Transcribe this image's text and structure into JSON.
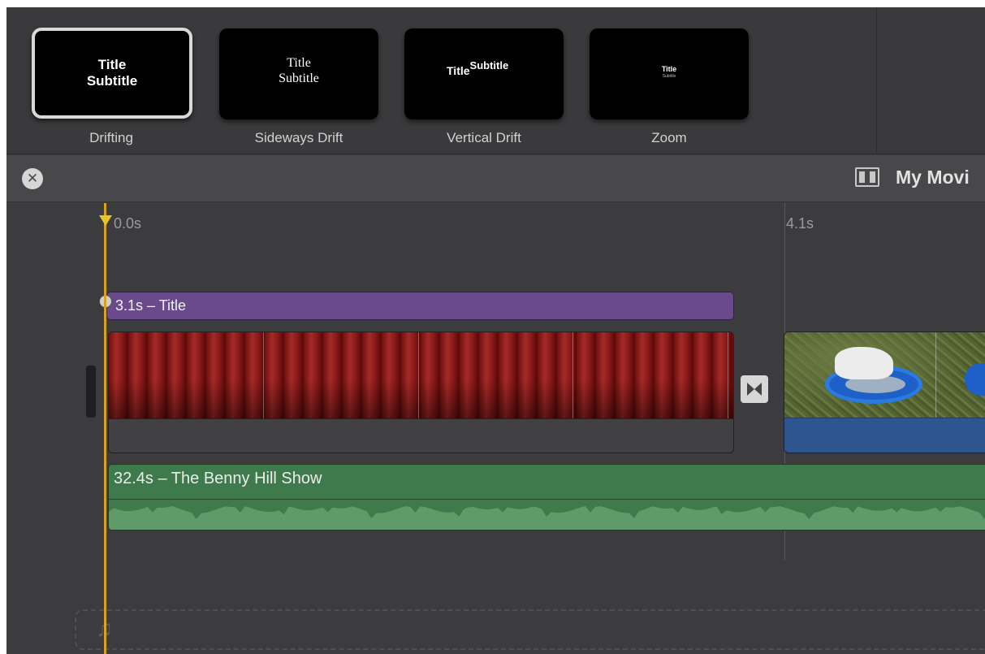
{
  "title_styles": [
    {
      "name": "Drifting",
      "preview_title": "Title",
      "preview_subtitle": "Subtitle",
      "selected": true
    },
    {
      "name": "Sideways Drift",
      "preview_title": "Title",
      "preview_subtitle": "Subtitle",
      "selected": false
    },
    {
      "name": "Vertical Drift",
      "preview_title": "Title",
      "preview_subtitle": "Subtitle",
      "selected": false
    },
    {
      "name": "Zoom",
      "preview_title": "Title",
      "preview_subtitle": "Subtitle",
      "selected": false
    }
  ],
  "header": {
    "close_icon": "close-circle-icon",
    "project_icon": "filmstrip-icon",
    "project_title": "My Movi"
  },
  "timeline": {
    "time_markers": [
      "0.0s",
      "4.1s"
    ],
    "title_clip": {
      "label": "3.1s – Title",
      "color": "#6b4a8c"
    },
    "video_clips": [
      {
        "name": "curtain-clip",
        "color": "#8a1a18"
      },
      {
        "name": "dog-clip",
        "color": "#2f5591"
      }
    ],
    "transition_icon": "transition-bowtie-icon",
    "music_clip": {
      "label": "32.4s – The Benny Hill Show",
      "color": "#3e7a4b"
    },
    "music_drop_icon": "music-note-icon",
    "music_note_glyph": "♫",
    "playhead_color": "#d9a21c"
  },
  "colors": {
    "background": "#3d3d40",
    "header_bar": "#48484b",
    "playhead": "#d9a21c",
    "title_clip": "#6b4a8c",
    "music_clip": "#3e7a4b"
  }
}
